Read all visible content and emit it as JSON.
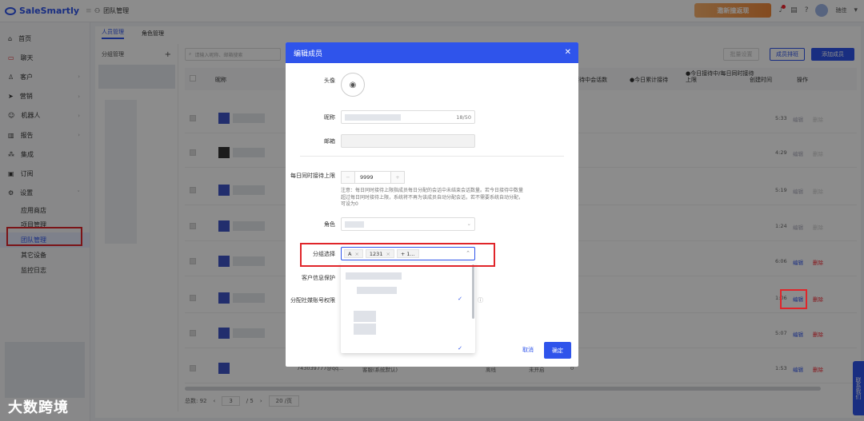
{
  "app": {
    "brand": "SaleSmartly",
    "breadcrumb": "团队管理",
    "promo": "邀新撞返现",
    "username": "驰佳"
  },
  "sidebar": {
    "items": [
      {
        "label": "首页",
        "icon": "home-icon",
        "glyph": "⌂"
      },
      {
        "label": "聊天",
        "icon": "chat-icon",
        "glyph": "▭"
      },
      {
        "label": "客户",
        "icon": "users-icon",
        "glyph": "♙"
      },
      {
        "label": "营销",
        "icon": "send-icon",
        "glyph": "➤"
      },
      {
        "label": "机器人",
        "icon": "robot-icon",
        "glyph": "☺"
      },
      {
        "label": "报告",
        "icon": "report-icon",
        "glyph": "▥"
      },
      {
        "label": "集成",
        "icon": "integration-icon",
        "glyph": "⁂"
      },
      {
        "label": "订阅",
        "icon": "subscription-icon",
        "glyph": "▣"
      },
      {
        "label": "设置",
        "icon": "settings-icon",
        "glyph": "⚙"
      }
    ],
    "subitems": [
      "应用商店",
      "项目管理",
      "团队管理",
      "其它设备",
      "监控日志"
    ]
  },
  "main": {
    "tabs": [
      "人员管理",
      "角色管理"
    ],
    "group_title": "分组管理",
    "search_placeholder": "请输入昵称、邮箱搜索",
    "buttons": {
      "batch": "批量设置",
      "schedule": "成员排班",
      "add": "添加成员"
    },
    "columns": [
      "昵称",
      "●接待中会话数",
      "●今日累计接待",
      "●今日接待中/每日同时接待上限",
      "创建时间",
      "操作"
    ],
    "rows": [
      {
        "time": "5:33",
        "edit": "编辑",
        "del": "删除"
      },
      {
        "time": "4:29",
        "edit": "编辑",
        "del": "删除"
      },
      {
        "time": "5:19",
        "edit": "编辑",
        "del": "删除"
      },
      {
        "time": "1:24",
        "edit": "编辑",
        "del": "删除"
      },
      {
        "time": "6:06",
        "edit": "编辑",
        "del": "删除"
      },
      {
        "time": "1:06",
        "edit": "编辑",
        "del": "删除"
      },
      {
        "time": "5:07",
        "edit": "编辑",
        "del": "删除"
      },
      {
        "time": "1:53",
        "edit": "编辑",
        "del": "删除"
      }
    ],
    "last_row_text": {
      "email": "743039777@qq...",
      "role": "客服(系统默认)",
      "status": "离线",
      "flag": "未开启",
      "zero": "0"
    },
    "pager": {
      "total": "总数: 92",
      "page": "3",
      "of": "/ 5",
      "size": "20 /页"
    },
    "contact": "联系我们"
  },
  "modal": {
    "title": "编辑成员",
    "labels": {
      "avatar": "头像",
      "nickname": "昵称",
      "email": "邮箱",
      "limit": "每日同时接待上限",
      "role": "角色",
      "group": "分组选择",
      "customer_info": "客户信息保护",
      "social": "分配社媒账号权限"
    },
    "nickname_count": "18/50",
    "limit_value": "9999",
    "note": "注意：每日同时接待上限指成员每日分配的会话中未结束会话数量。若今日接待中数量超过每日同时接待上限，系统将不再为该成员自动分配会话，若不需要系统自动分配，可设为0",
    "tags": [
      "A",
      "1231",
      "+ 1..."
    ],
    "cancel": "取消",
    "ok": "确定"
  },
  "watermark": "大数跨境"
}
